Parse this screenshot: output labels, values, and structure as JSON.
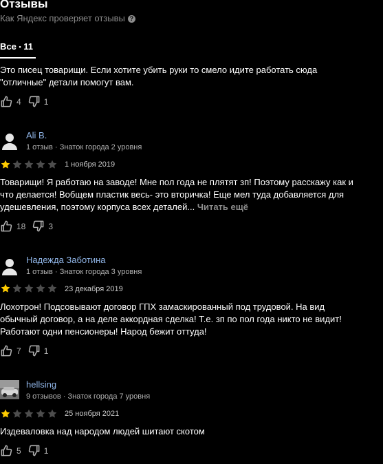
{
  "header": {
    "title": "Отзывы",
    "subtitle": "Как Яндекс проверяет отзывы",
    "tab_label": "Все",
    "tab_sep": "•",
    "tab_count": "11"
  },
  "top_review": {
    "text": "Это писец товарищи. Если хотите убить руки то смело идите работать сюда \"отличные\" детали помогут вам.",
    "likes": "4",
    "dislikes": "1"
  },
  "reviews": [
    {
      "author": "Ali B.",
      "review_count": "1 отзыв",
      "level": "Знаток города 2 уровня",
      "rating": 1,
      "date": "1 ноября 2019",
      "text": "Товарищи! Я работаю на заводе! Мне пол года не плятят зп! Поэтому расскажу как и что делается! Вобщем пластик весь- это вторичка! Еще мел туда добавляется для удешевления, поэтому корпуса всех деталей...",
      "read_more": "Читать ещё",
      "likes": "18",
      "dislikes": "3"
    },
    {
      "author": "Надежда Заботина",
      "review_count": "1 отзыв",
      "level": "Знаток города 3 уровня",
      "rating": 1,
      "date": "23 декабря 2019",
      "text": "Лохотрон! Подсовывают договор ГПХ замаскированный под трудовой. На вид обычный договор, а на деле аккордная сделка! Т.е. зп по пол года никто не видит! Работают одни пенсионеры! Народ бежит оттуда!",
      "likes": "7",
      "dislikes": "1"
    },
    {
      "author": "hellsing",
      "review_count": "9 отзывов",
      "level": "Знаток города 7 уровня",
      "rating": 1,
      "date": "25 ноября 2021",
      "text": "Издеваловка над народом людей шитают скотом",
      "likes": "5",
      "dislikes": "1"
    }
  ],
  "meta_separator": "·",
  "colors": {
    "background": "#000000",
    "text": "#ffffff",
    "muted": "#8c8c8c",
    "author_link": "#8fb4e6",
    "star_active": "#fc0",
    "star_inactive": "#4d4d4d"
  }
}
